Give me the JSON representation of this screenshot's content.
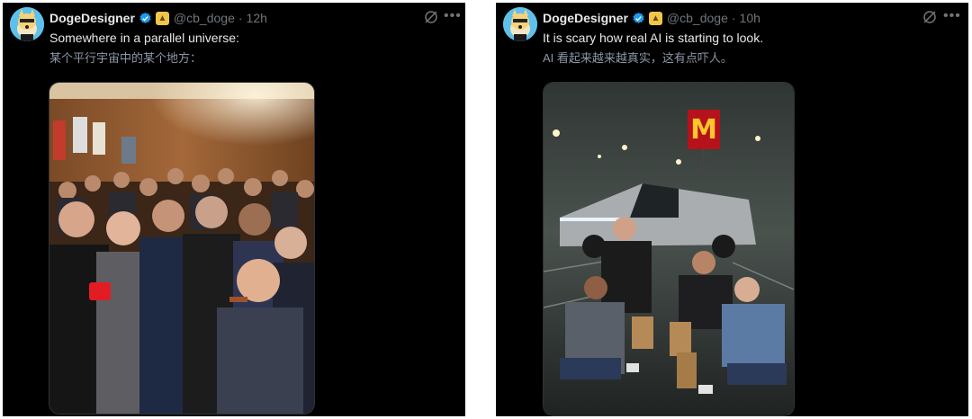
{
  "posts": [
    {
      "author_name": "DogeDesigner",
      "handle": "@cb_doge",
      "separator": "·",
      "time": "12h",
      "text_en": "Somewhere in a parallel universe:",
      "text_zh": "某个平行宇宙中的某个地方："
    },
    {
      "author_name": "DogeDesigner",
      "handle": "@cb_doge",
      "separator": "·",
      "time": "10h",
      "text_en": "It is scary how real AI is starting to look.",
      "text_zh": "AI 看起来越来越真实，这有点吓人。"
    }
  ],
  "icons": {
    "verified": "verified-badge-icon",
    "affiliate": "doge-affiliate-icon",
    "grok": "grok-icon",
    "more": "more-options-icon"
  },
  "colors": {
    "background": "#000000",
    "primary_text": "#e7e9ea",
    "secondary_text": "#71767b",
    "verified_blue": "#1d9bf0",
    "avatar_bg": "#5ec1ec"
  }
}
